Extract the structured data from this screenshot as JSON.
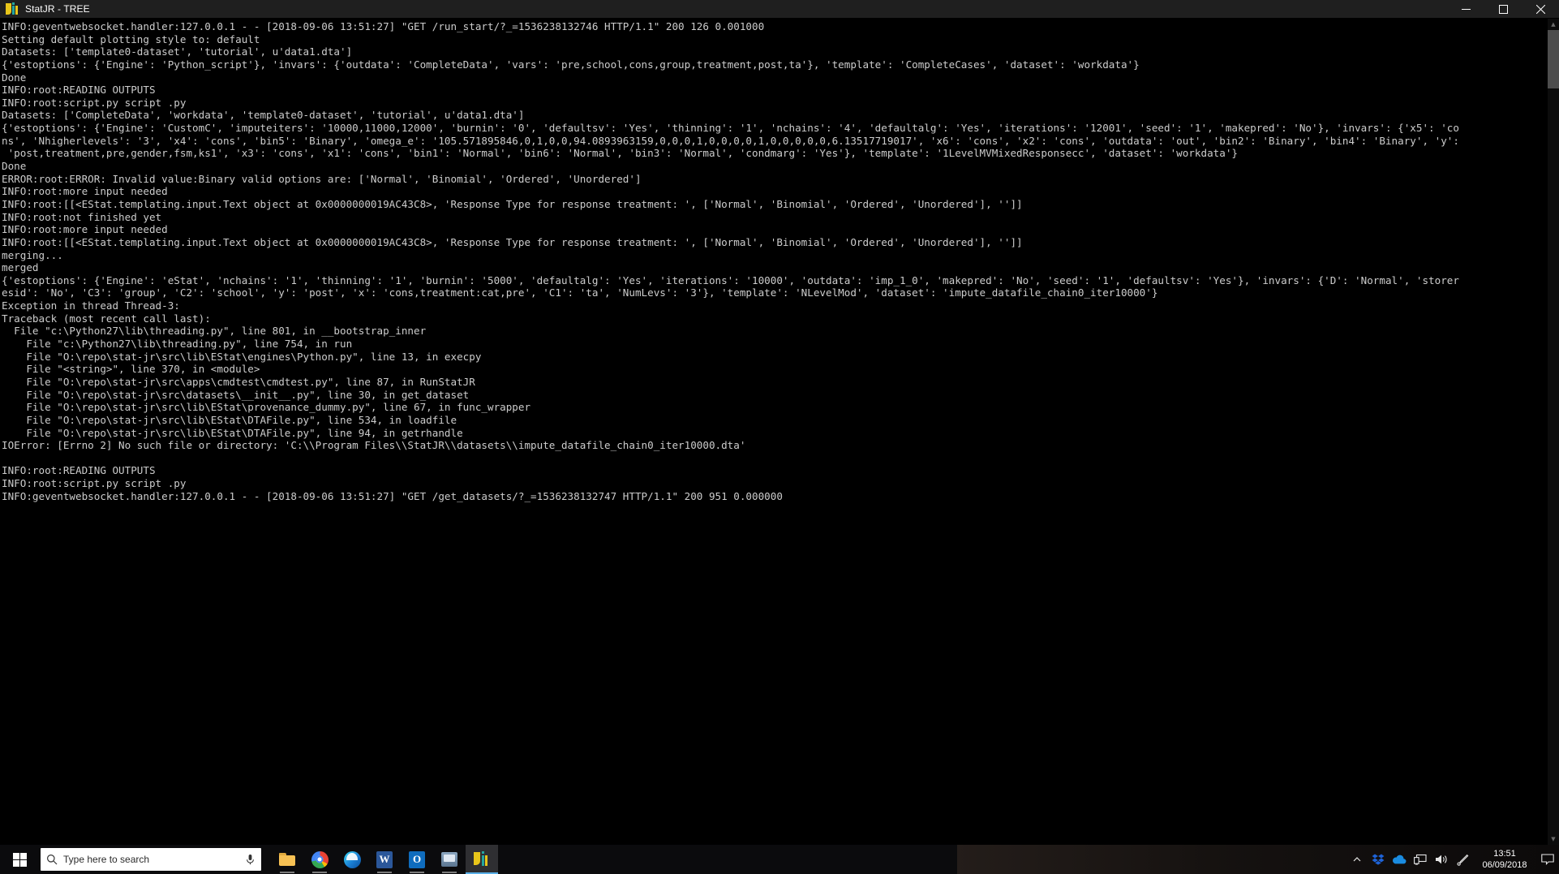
{
  "window": {
    "title": "StatJR - TREE",
    "icon": "statjr-icon",
    "buttons": {
      "minimize": "minimize-icon",
      "maximize": "maximize-icon",
      "close": "close-icon"
    }
  },
  "console": {
    "lines": [
      "INFO:geventwebsocket.handler:127.0.0.1 - - [2018-09-06 13:51:27] \"GET /run_start/?_=1536238132746 HTTP/1.1\" 200 126 0.001000",
      "Setting default plotting style to: default",
      "Datasets: ['template0-dataset', 'tutorial', u'data1.dta']",
      "{'estoptions': {'Engine': 'Python_script'}, 'invars': {'outdata': 'CompleteData', 'vars': 'pre,school,cons,group,treatment,post,ta'}, 'template': 'CompleteCases', 'dataset': 'workdata'}",
      "Done",
      "INFO:root:READING OUTPUTS",
      "INFO:root:script.py script .py",
      "Datasets: ['CompleteData', 'workdata', 'template0-dataset', 'tutorial', u'data1.dta']",
      "{'estoptions': {'Engine': 'CustomC', 'imputeiters': '10000,11000,12000', 'burnin': '0', 'defaultsv': 'Yes', 'thinning': '1', 'nchains': '4', 'defaultalg': 'Yes', 'iterations': '12001', 'seed': '1', 'makepred': 'No'}, 'invars': {'x5': 'co",
      "ns', 'Nhigherlevels': '3', 'x4': 'cons', 'bin5': 'Binary', 'omega_e': '105.571895846,0,1,0,0,94.0893963159,0,0,0,1,0,0,0,0,1,0,0,0,0,0,6.13517719017', 'x6': 'cons', 'x2': 'cons', 'outdata': 'out', 'bin2': 'Binary', 'bin4': 'Binary', 'y':",
      " 'post,treatment,pre,gender,fsm,ks1', 'x3': 'cons', 'x1': 'cons', 'bin1': 'Normal', 'bin6': 'Normal', 'bin3': 'Normal', 'condmarg': 'Yes'}, 'template': '1LevelMVMixedResponsecc', 'dataset': 'workdata'}",
      "Done",
      "ERROR:root:ERROR: Invalid value:Binary valid options are: ['Normal', 'Binomial', 'Ordered', 'Unordered']",
      "INFO:root:more input needed",
      "INFO:root:[[<EStat.templating.input.Text object at 0x0000000019AC43C8>, 'Response Type for response treatment: ', ['Normal', 'Binomial', 'Ordered', 'Unordered'], '']]",
      "INFO:root:not finished yet",
      "INFO:root:more input needed",
      "INFO:root:[[<EStat.templating.input.Text object at 0x0000000019AC43C8>, 'Response Type for response treatment: ', ['Normal', 'Binomial', 'Ordered', 'Unordered'], '']]",
      "merging...",
      "merged",
      "{'estoptions': {'Engine': 'eStat', 'nchains': '1', 'thinning': '1', 'burnin': '5000', 'defaultalg': 'Yes', 'iterations': '10000', 'outdata': 'imp_1_0', 'makepred': 'No', 'seed': '1', 'defaultsv': 'Yes'}, 'invars': {'D': 'Normal', 'storer",
      "esid': 'No', 'C3': 'group', 'C2': 'school', 'y': 'post', 'x': 'cons,treatment:cat,pre', 'C1': 'ta', 'NumLevs': '3'}, 'template': 'NLevelMod', 'dataset': 'impute_datafile_chain0_iter10000'}",
      "Exception in thread Thread-3:",
      "Traceback (most recent call last):",
      "  File \"c:\\Python27\\lib\\threading.py\", line 801, in __bootstrap_inner",
      "    File \"c:\\Python27\\lib\\threading.py\", line 754, in run",
      "    File \"O:\\repo\\stat-jr\\src\\lib\\EStat\\engines\\Python.py\", line 13, in execpy",
      "    File \"<string>\", line 370, in <module>",
      "    File \"O:\\repo\\stat-jr\\src\\apps\\cmdtest\\cmdtest.py\", line 87, in RunStatJR",
      "    File \"O:\\repo\\stat-jr\\src\\datasets\\__init__.py\", line 30, in get_dataset",
      "    File \"O:\\repo\\stat-jr\\src\\lib\\EStat\\provenance_dummy.py\", line 67, in func_wrapper",
      "    File \"O:\\repo\\stat-jr\\src\\lib\\EStat\\DTAFile.py\", line 534, in loadfile",
      "    File \"O:\\repo\\stat-jr\\src\\lib\\EStat\\DTAFile.py\", line 94, in getrhandle",
      "IOError: [Errno 2] No such file or directory: 'C:\\\\Program Files\\\\StatJR\\\\datasets\\\\impute_datafile_chain0_iter10000.dta'",
      "",
      "INFO:root:READING OUTPUTS",
      "INFO:root:script.py script .py",
      "INFO:geventwebsocket.handler:127.0.0.1 - - [2018-09-06 13:51:27] \"GET /get_datasets/?_=1536238132747 HTTP/1.1\" 200 951 0.000000"
    ]
  },
  "scrollbar": {
    "up_arrow": "scroll-up-icon",
    "down_arrow": "scroll-down-icon"
  },
  "taskbar": {
    "start": "windows-start-icon",
    "search": {
      "placeholder": "Type here to search",
      "value": "",
      "icon": "search-icon",
      "mic_icon": "microphone-icon"
    },
    "apps": [
      {
        "name": "file-explorer",
        "icon": "folder-icon",
        "active": false,
        "running": true
      },
      {
        "name": "google-chrome",
        "icon": "chrome-icon",
        "active": false,
        "running": true
      },
      {
        "name": "microsoft-edge",
        "icon": "edge-icon",
        "active": false,
        "running": false
      },
      {
        "name": "microsoft-word",
        "icon": "word-icon",
        "label": "W",
        "active": false,
        "running": true
      },
      {
        "name": "microsoft-outlook",
        "icon": "outlook-icon",
        "label": "O",
        "active": false,
        "running": true
      },
      {
        "name": "remote-desktop",
        "icon": "app-window-icon",
        "active": false,
        "running": true
      },
      {
        "name": "statjr",
        "icon": "statjr-icon",
        "active": true,
        "running": true
      }
    ],
    "tray": [
      {
        "name": "show-hidden-icons",
        "icon": "chevron-up-icon"
      },
      {
        "name": "dropbox",
        "icon": "dropbox-icon"
      },
      {
        "name": "onedrive",
        "icon": "cloud-icon"
      },
      {
        "name": "network",
        "icon": "monitor-network-icon"
      },
      {
        "name": "volume",
        "icon": "speaker-icon"
      },
      {
        "name": "bluetooth-or-pen",
        "icon": "pen-icon"
      }
    ],
    "clock": {
      "time": "13:51",
      "date": "06/09/2018"
    },
    "action_center": "notification-icon"
  },
  "colors": {
    "console_bg": "#000000",
    "console_text": "#cccccc",
    "titlebar_bg": "#1f1f1f",
    "taskbar_bg": "#0b0b0d",
    "accent": "#5ab0e8"
  }
}
